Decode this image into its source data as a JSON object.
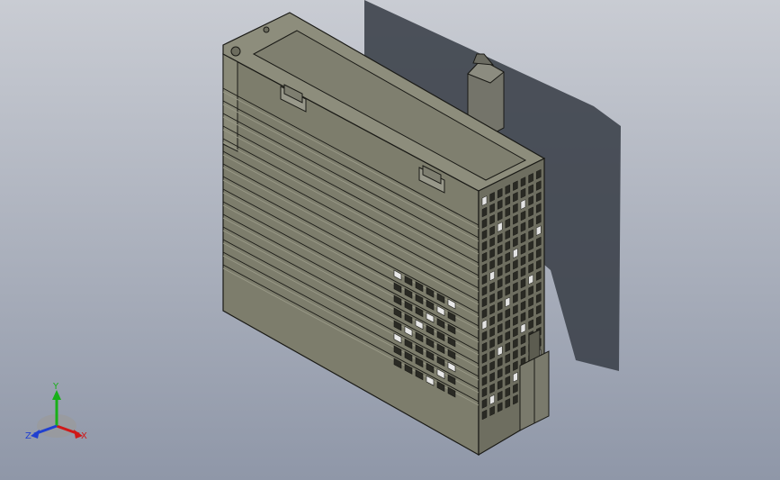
{
  "viewport": {
    "background_top": "#c9ccd3",
    "background_bottom": "#8f97a8"
  },
  "model": {
    "description_colors": {
      "front_face": "#7d7d6c",
      "top_face": "#8b8b7a",
      "right_face": "#6b6b5c",
      "edge": "#1a1a16",
      "shadow": "#3e444c"
    }
  },
  "triad": {
    "x_label": "X",
    "y_label": "Y",
    "z_label": "Z",
    "x_color": "#d01818",
    "y_color": "#18b018",
    "z_color": "#2040d0"
  }
}
